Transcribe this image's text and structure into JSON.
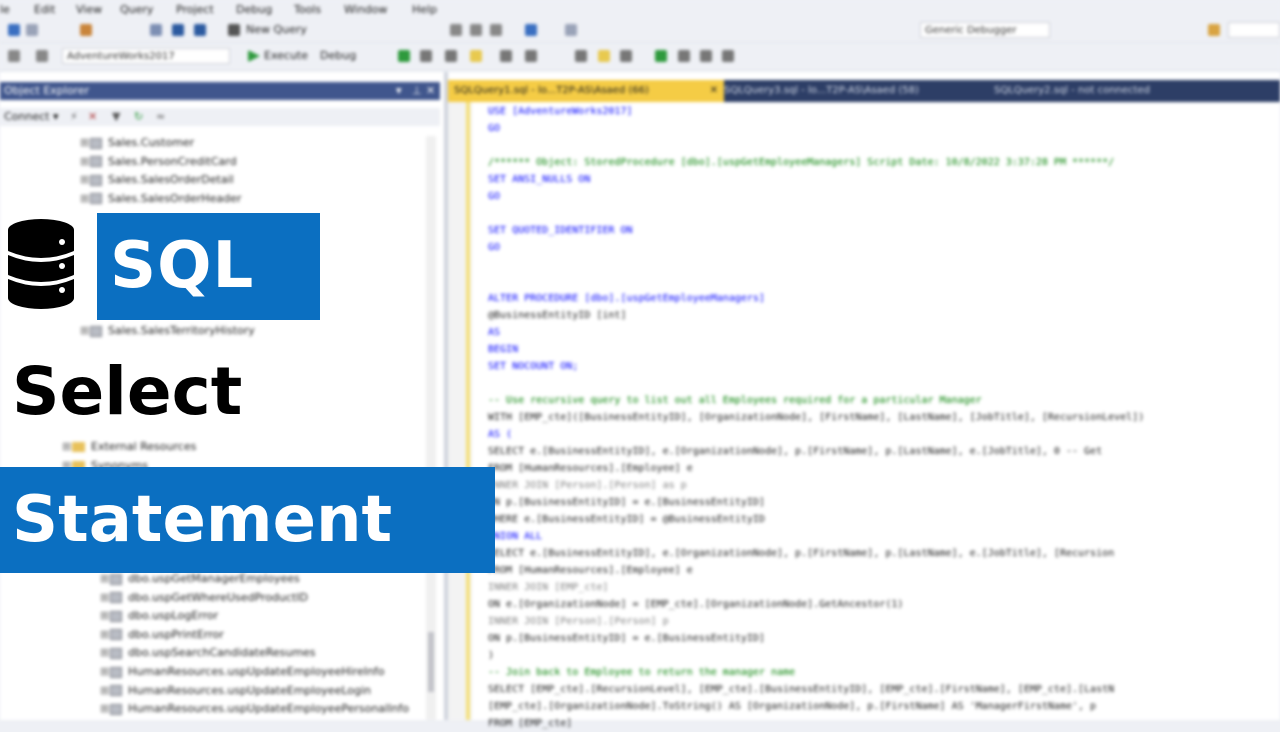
{
  "menu": [
    "le",
    "Edit",
    "View",
    "Query",
    "Project",
    "Debug",
    "Tools",
    "Window",
    "Help"
  ],
  "toolbar": {
    "new_query": "New Query",
    "generic_debugger": "Generic Debugger",
    "database": "AdventureWorks2017",
    "execute": "Execute",
    "debug": "Debug"
  },
  "object_explorer": {
    "title": "Object Explorer",
    "connect": "Connect ▾",
    "tree_top": [
      "Sales.Customer",
      "Sales.PersonCreditCard",
      "Sales.SalesOrderDetail",
      "Sales.SalesOrderHeader",
      "Sales.SalesTerritoryHistory"
    ],
    "tree_folders": [
      "External Resources",
      "Synonyms"
    ],
    "tree_bottom": [
      "dbo.uspGetManagerEmployees",
      "dbo.uspGetWhereUsedProductID",
      "dbo.uspLogError",
      "dbo.uspPrintError",
      "dbo.uspSearchCandidateResumes",
      "HumanResources.uspUpdateEmployeeHireInfo",
      "HumanResources.uspUpdateEmployeeLogin",
      "HumanResources.uspUpdateEmployeePersonalInfo"
    ]
  },
  "editor": {
    "tabs": [
      "SQLQuery1.sql - lo...T2P-AS\\Asaed (66)",
      "SQLQuery3.sql - lo...T2P-AS\\Asaed (58)",
      "SQLQuery2.sql - not connected"
    ],
    "lines": [
      {
        "t": "USE [AdventureWorks2017]",
        "c": "kw"
      },
      {
        "t": "GO",
        "c": "kw"
      },
      {
        "t": "",
        "c": "tx"
      },
      {
        "t": "/****** Object:  StoredProcedure [dbo].[uspGetEmployeeManagers]    Script Date: 10/8/2022 3:37:28 PM ******/",
        "c": "cm"
      },
      {
        "t": "SET ANSI_NULLS ON",
        "c": "kw"
      },
      {
        "t": "GO",
        "c": "kw"
      },
      {
        "t": "",
        "c": "tx"
      },
      {
        "t": "SET QUOTED_IDENTIFIER ON",
        "c": "kw"
      },
      {
        "t": "GO",
        "c": "kw"
      },
      {
        "t": "",
        "c": "tx"
      },
      {
        "t": "",
        "c": "tx"
      },
      {
        "t": "ALTER PROCEDURE [dbo].[uspGetEmployeeManagers]",
        "c": "kw"
      },
      {
        "t": "    @BusinessEntityID [int]",
        "c": "tx"
      },
      {
        "t": "AS",
        "c": "kw"
      },
      {
        "t": "BEGIN",
        "c": "kw"
      },
      {
        "t": "    SET NOCOUNT ON;",
        "c": "kw"
      },
      {
        "t": "",
        "c": "tx"
      },
      {
        "t": "    -- Use recursive query to list out all Employees required for a particular Manager",
        "c": "cm"
      },
      {
        "t": "    WITH [EMP_cte]([BusinessEntityID], [OrganizationNode], [FirstName], [LastName], [JobTitle], [RecursionLevel])",
        "c": "tx"
      },
      {
        "t": "    AS (",
        "c": "kw"
      },
      {
        "t": "        SELECT e.[BusinessEntityID], e.[OrganizationNode], p.[FirstName], p.[LastName], e.[JobTitle], 0 -- Get",
        "c": "tx"
      },
      {
        "t": "        FROM [HumanResources].[Employee] e",
        "c": "tx"
      },
      {
        "t": "            INNER JOIN [Person].[Person] as p",
        "c": "gy"
      },
      {
        "t": "            ON p.[BusinessEntityID] = e.[BusinessEntityID]",
        "c": "tx"
      },
      {
        "t": "        WHERE e.[BusinessEntityID] = @BusinessEntityID",
        "c": "tx"
      },
      {
        "t": "        UNION ALL",
        "c": "kw"
      },
      {
        "t": "        SELECT e.[BusinessEntityID], e.[OrganizationNode], p.[FirstName], p.[LastName], e.[JobTitle], [Recursion",
        "c": "tx"
      },
      {
        "t": "        FROM [HumanResources].[Employee] e",
        "c": "tx"
      },
      {
        "t": "            INNER JOIN [EMP_cte]",
        "c": "gy"
      },
      {
        "t": "            ON e.[OrganizationNode] = [EMP_cte].[OrganizationNode].GetAncestor(1)",
        "c": "tx"
      },
      {
        "t": "            INNER JOIN [Person].[Person] p",
        "c": "gy"
      },
      {
        "t": "            ON p.[BusinessEntityID] = e.[BusinessEntityID]",
        "c": "tx"
      },
      {
        "t": "    )",
        "c": "tx"
      },
      {
        "t": "    -- Join back to Employee to return the manager name",
        "c": "cm"
      },
      {
        "t": "    SELECT [EMP_cte].[RecursionLevel], [EMP_cte].[BusinessEntityID], [EMP_cte].[FirstName], [EMP_cte].[LastN",
        "c": "tx"
      },
      {
        "t": "        [EMP_cte].[OrganizationNode].ToString() AS [OrganizationNode], p.[FirstName] AS 'ManagerFirstName', p",
        "c": "tx"
      },
      {
        "t": "    FROM [EMP_cte]",
        "c": "tx"
      }
    ]
  },
  "overlay": {
    "line1": "SQL",
    "line2": "Select",
    "line3": "Statement"
  },
  "colors": {
    "accent_blue": "#0b6fc1",
    "active_tab": "#f5cc45",
    "panel_title": "#40568d"
  }
}
